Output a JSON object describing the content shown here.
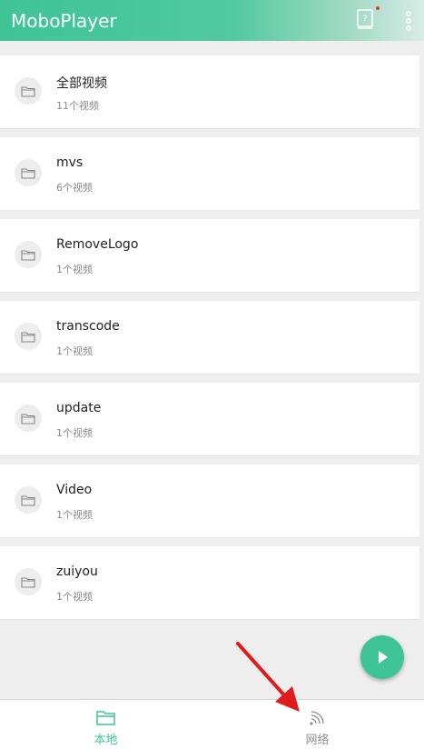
{
  "app": {
    "title": "MoboPlayer"
  },
  "folders": [
    {
      "name": "全部视频",
      "count": "11个视频"
    },
    {
      "name": "mvs",
      "count": "6个视频"
    },
    {
      "name": "RemoveLogo",
      "count": "1个视频"
    },
    {
      "name": "transcode",
      "count": "1个视频"
    },
    {
      "name": "update",
      "count": "1个视频"
    },
    {
      "name": "Video",
      "count": "1个视频"
    },
    {
      "name": "zuiyou",
      "count": "1个视频"
    }
  ],
  "bottom_nav": {
    "local_label": "本地",
    "network_label": "网络"
  },
  "colors": {
    "accent": "#3ec497",
    "arrow": "#e01b1b"
  }
}
